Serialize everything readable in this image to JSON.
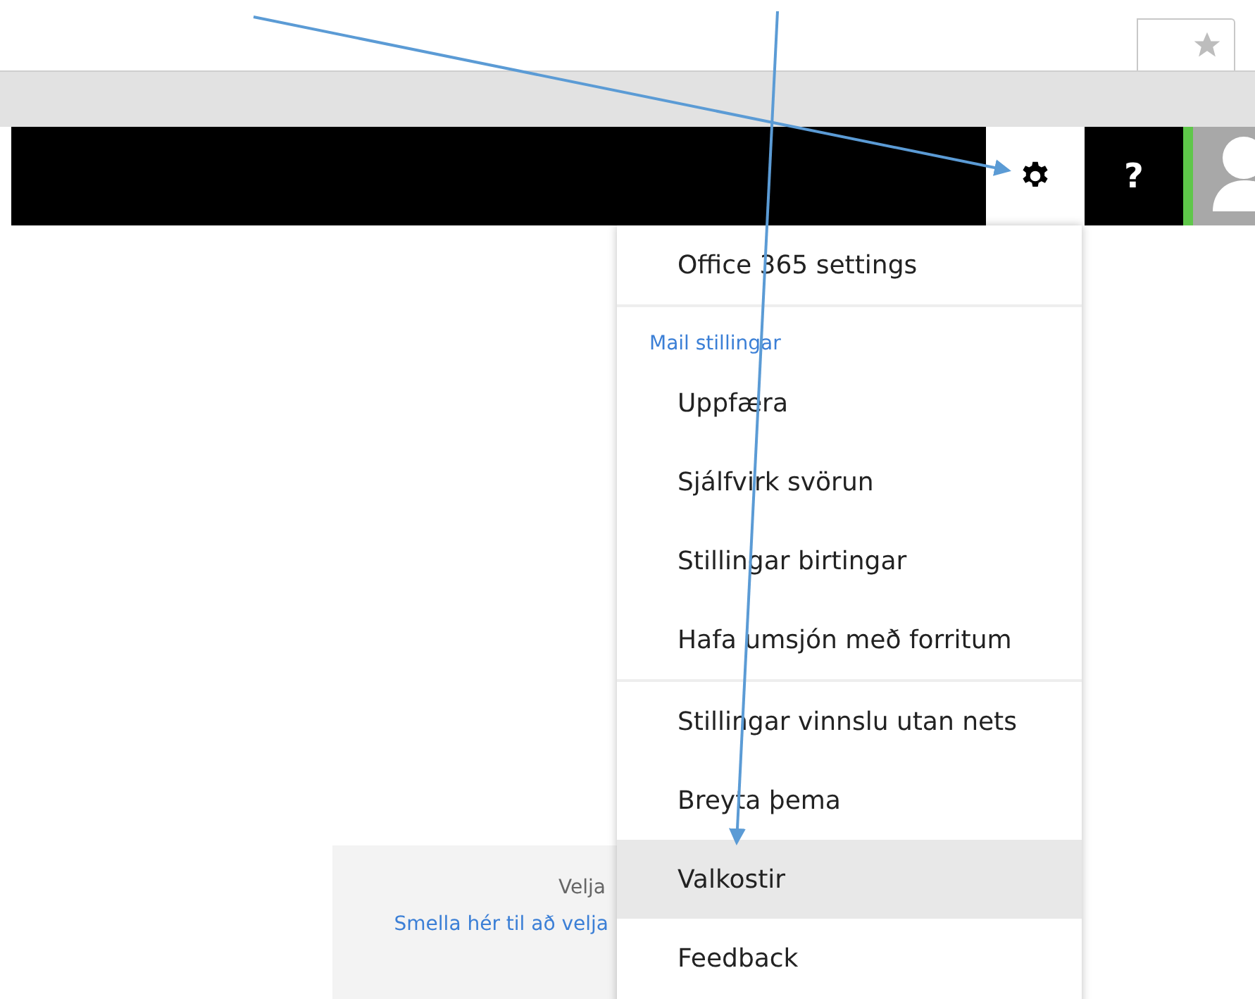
{
  "header": {
    "buttons": [
      {
        "kind": "gear",
        "selected": true
      },
      {
        "kind": "help",
        "label": "?",
        "selected": false
      }
    ]
  },
  "settings_menu": {
    "groups": [
      {
        "items": [
          {
            "label": "Office 365 settings",
            "selected": false
          }
        ]
      },
      {
        "heading": "Mail stillingar",
        "items": [
          {
            "label": "Uppfæra",
            "selected": false
          },
          {
            "label": "Sjálfvirk svörun",
            "selected": false
          },
          {
            "label": "Stillingar birtingar",
            "selected": false
          },
          {
            "label": "Hafa umsjón með forritum",
            "selected": false
          }
        ]
      },
      {
        "items": [
          {
            "label": "Stillingar vinnslu utan nets",
            "selected": false
          },
          {
            "label": "Breyta þema",
            "selected": false
          },
          {
            "label": "Valkostir",
            "selected": true
          },
          {
            "label": "Feedback",
            "selected": false
          }
        ]
      }
    ]
  },
  "background_panel": {
    "title": "Velja",
    "link": "Smella hér til að velja"
  }
}
